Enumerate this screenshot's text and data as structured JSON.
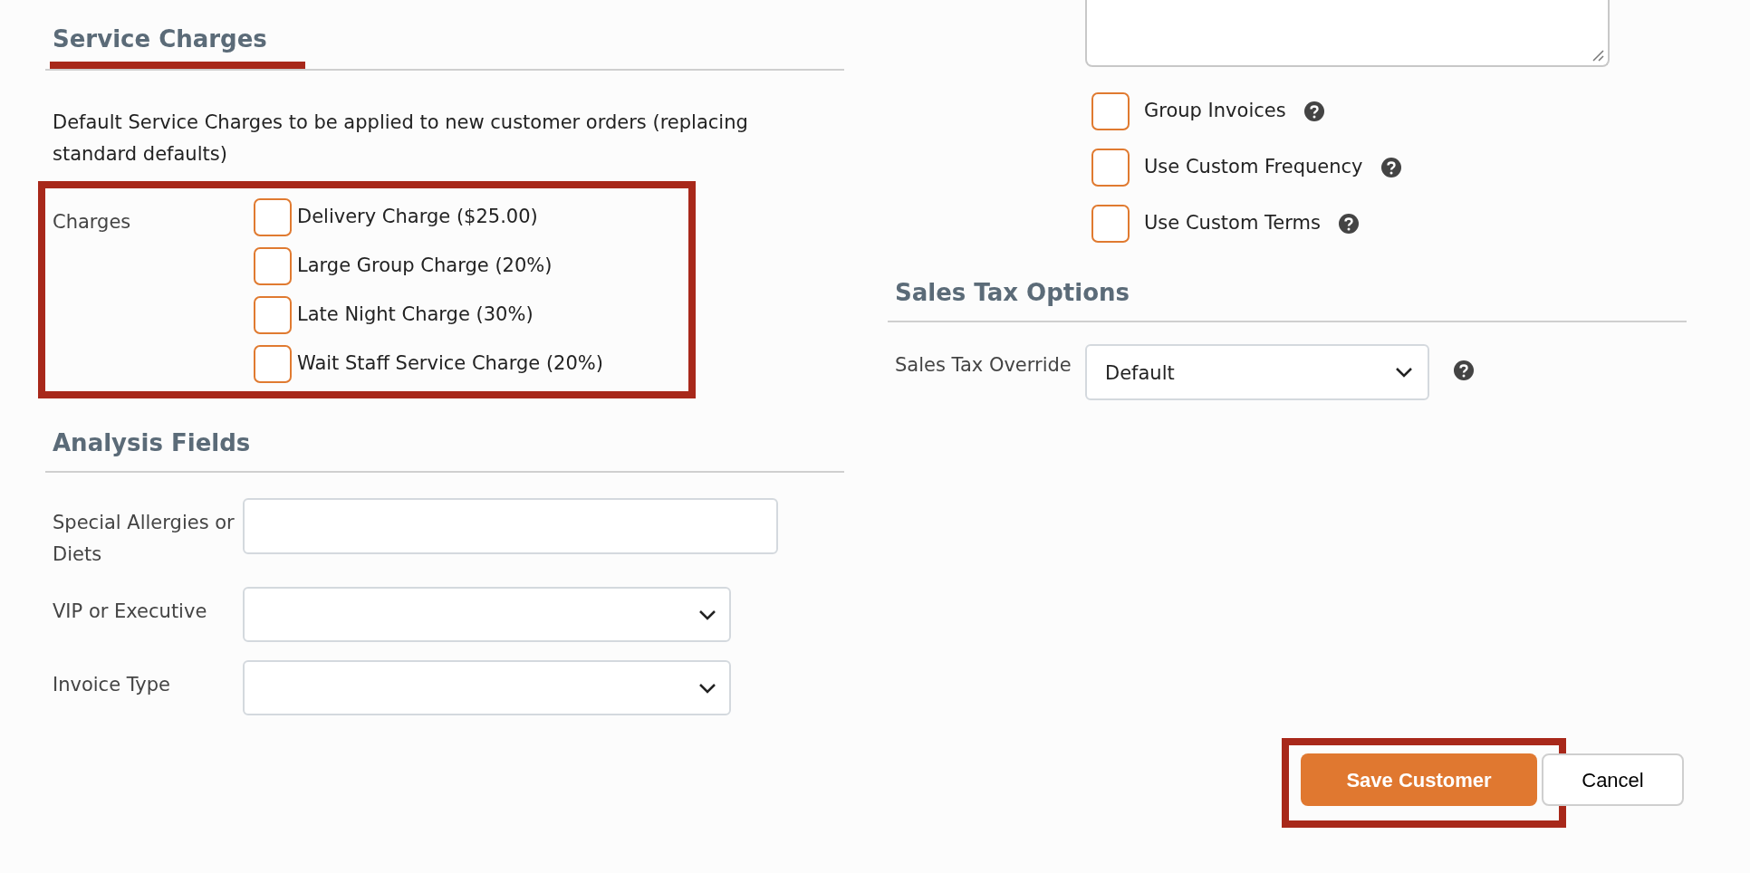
{
  "service_charges": {
    "title": "Service Charges",
    "description": "Default Service Charges to be applied to new customer orders (replacing standard defaults)",
    "charges_label": "Charges",
    "highlighted": true,
    "charges": [
      {
        "label": "Delivery Charge ($25.00)",
        "checked": false
      },
      {
        "label": "Large Group Charge (20%)",
        "checked": false
      },
      {
        "label": "Late Night Charge (30%)",
        "checked": false
      },
      {
        "label": "Wait Staff Service Charge (20%)",
        "checked": false
      }
    ]
  },
  "analysis_fields": {
    "title": "Analysis Fields",
    "fields": [
      {
        "kind": "text",
        "label": "Special Allergies or Diets"
      },
      {
        "kind": "select",
        "label": "VIP or Executive"
      },
      {
        "kind": "select",
        "label": "Invoice Type"
      }
    ]
  },
  "invoice_options": [
    {
      "label": "Group Invoices",
      "checked": false
    },
    {
      "label": "Use Custom Frequency",
      "checked": false
    },
    {
      "label": "Use Custom Terms",
      "checked": false
    }
  ],
  "sales_tax": {
    "title": "Sales Tax Options",
    "override_label": "Sales Tax Override",
    "override_value": "Default"
  },
  "buttons": [
    {
      "label": "Save Customer",
      "kind": "primary",
      "highlighted": true
    },
    {
      "label": "Cancel",
      "kind": "secondary",
      "highlighted": false
    }
  ]
}
